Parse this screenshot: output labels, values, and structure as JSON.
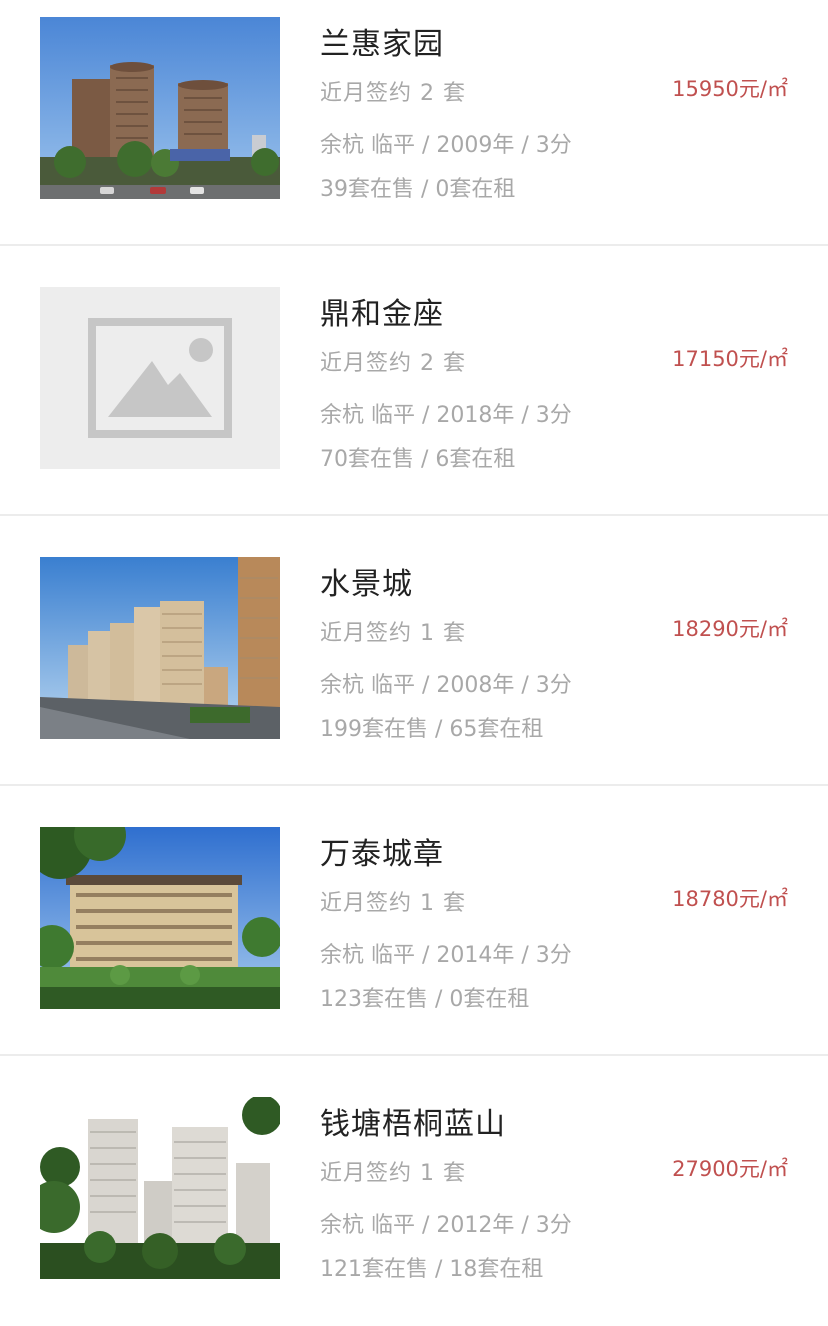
{
  "listings": [
    {
      "name": "兰惠家园",
      "deals": "近月签约 2 套",
      "price": "15950元/㎡",
      "meta": "余杭 临平 / 2009年 / 3分",
      "stock": "39套在售 / 0套在租",
      "image": "photo-twin-towers"
    },
    {
      "name": "鼎和金座",
      "deals": "近月签约 2 套",
      "price": "17150元/㎡",
      "meta": "余杭 临平 / 2018年 / 3分",
      "stock": "70套在售 / 6套在租",
      "image": "placeholder-image-icon"
    },
    {
      "name": "水景城",
      "deals": "近月签约 1 套",
      "price": "18290元/㎡",
      "meta": "余杭 临平 / 2008年 / 3分",
      "stock": "199套在售 / 65套在租",
      "image": "photo-apartment-row"
    },
    {
      "name": "万泰城章",
      "deals": "近月签约 1 套",
      "price": "18780元/㎡",
      "meta": "余杭 临平 / 2014年 / 3分",
      "stock": "123套在售 / 0套在租",
      "image": "photo-lowrise-rendering"
    },
    {
      "name": "钱塘梧桐蓝山",
      "deals": "近月签约 1 套",
      "price": "27900元/㎡",
      "meta": "余杭 临平 / 2012年 / 3分",
      "stock": "121套在售 / 18套在租",
      "image": "photo-highrise-cluster"
    }
  ],
  "colors": {
    "price": "#c0504f",
    "secondary_text": "#a8a8a8",
    "title_text": "#222222",
    "divider": "#ececec"
  }
}
